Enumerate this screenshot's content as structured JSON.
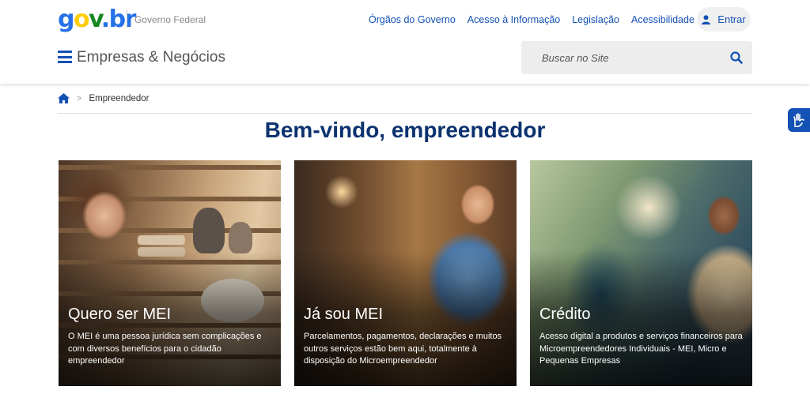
{
  "header": {
    "logo": {
      "g": "g",
      "o": "o",
      "v": "v",
      "dot": ".",
      "br": "br"
    },
    "subtitle": "Governo Federal",
    "links": [
      "Órgãos do Governo",
      "Acesso à Informação",
      "Legislação",
      "Acessibilidade"
    ],
    "login_label": "Entrar",
    "site_title": "Empresas & Negócios",
    "search_placeholder": "Buscar no Site"
  },
  "breadcrumb": {
    "current": "Empreendedor"
  },
  "page_title": "Bem-vindo, empreendedor",
  "cards": [
    {
      "title": "Quero ser MEI",
      "text": "O MEI é uma pessoa jurídica sem complicações e com diversos benefícios para o cidadão empreendedor"
    },
    {
      "title": "Já sou MEI",
      "text": "Parcelamentos, pagamentos, declarações e muitos outros serviços estão bem aqui, totalmente à disposição do Microempreendedor"
    },
    {
      "title": "Crédito",
      "text": "Acesso digital a produtos e serviços financeiros para Microempreendedores Individuais - MEI, Micro e Pequenas Empresas"
    }
  ],
  "icons": {
    "menu": "hamburger-icon",
    "search": "search-icon",
    "user": "user-icon",
    "home": "home-icon",
    "contrast": "contrast-icon",
    "accessibility": "sign-language-icon"
  },
  "colors": {
    "primary": "#1351b4",
    "title": "#0c326f"
  }
}
